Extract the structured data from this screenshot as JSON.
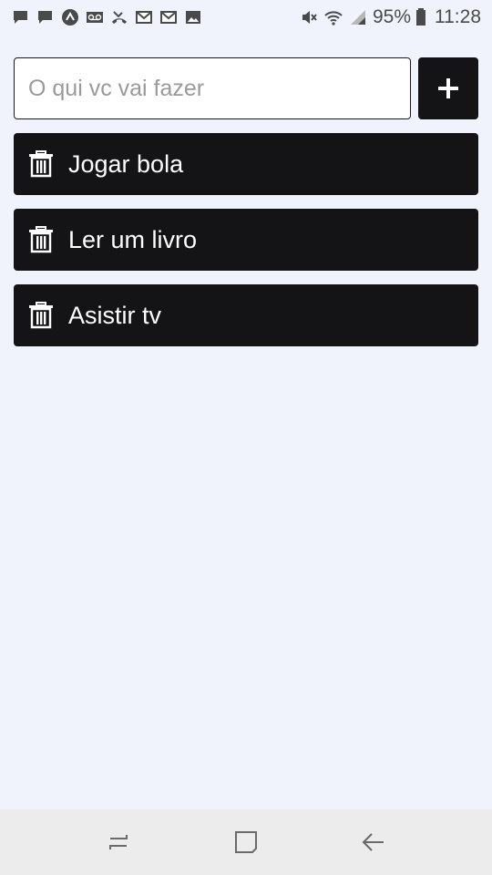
{
  "status_bar": {
    "left_icons": [
      "chat-icon",
      "chat-icon",
      "app-icon",
      "voicemail-icon",
      "missed-call-icon",
      "mail-icon",
      "mail-icon",
      "image-icon"
    ],
    "right_icons": [
      "mute-icon",
      "wifi-icon",
      "signal-icon"
    ],
    "battery": "95%",
    "time": "11:28"
  },
  "input": {
    "placeholder": "O qui vc vai fazer",
    "value": ""
  },
  "add_button": {
    "label": "+"
  },
  "tasks": [
    {
      "label": "Jogar bola"
    },
    {
      "label": "Ler um livro"
    },
    {
      "label": "Asistir tv"
    }
  ],
  "colors": {
    "background": "#f0f3fc",
    "item_bg": "#141416",
    "nav_bg": "#ececec"
  }
}
